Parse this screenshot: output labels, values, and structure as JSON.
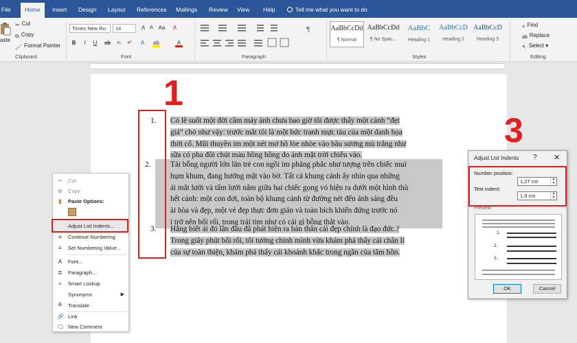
{
  "tabs": [
    {
      "label": "File"
    },
    {
      "label": "Home"
    },
    {
      "label": "Insert"
    },
    {
      "label": "Design"
    },
    {
      "label": "Layout"
    },
    {
      "label": "References"
    },
    {
      "label": "Mailings"
    },
    {
      "label": "Review"
    },
    {
      "label": "View"
    },
    {
      "label": "Help"
    }
  ],
  "tell_me": "Tell me what you want to do",
  "ribbon": {
    "clipboard": {
      "paste": "aste",
      "cut": "Cut",
      "copy": "Copy",
      "format_painter": "Format Painter",
      "label": "Clipboard"
    },
    "font": {
      "name": "Times New Ro",
      "size": "14",
      "label": "Font"
    },
    "paragraph": {
      "label": "Paragraph"
    },
    "styles": {
      "items": [
        {
          "sample": "AaBbCcDd",
          "name": "¶ Normal"
        },
        {
          "sample": "AaBbCcDd",
          "name": "¶ No Spac..."
        },
        {
          "sample": "AaBbC",
          "name": "Heading 1"
        },
        {
          "sample": "AaBbCcD",
          "name": "Heading 2"
        },
        {
          "sample": "AaBbCcD",
          "name": "Heading 3"
        }
      ],
      "label": "Styles"
    },
    "editing": {
      "find": "Find",
      "replace": "Replace",
      "select": "Select",
      "label": "Editing"
    }
  },
  "document": {
    "items": [
      {
        "number": "1.",
        "lines": [
          "Có lẽ suốt một đời cầm máy ảnh chưa bao giờ tôi được thấy một cảnh “đẹt",
          "giá” chó như vậy: trước mắt tôi là một bức tranh mực tàu của một danh họa",
          "thời cổ. Mũi thuyền im một nét mơ hồ lòe nhòe vào bầu sương mù trắng như",
          "sữa có pha đôi chút màu hồng hồng do ánh mặt trời chiếu vào."
        ]
      },
      {
        "number": "2.",
        "lines": [
          "Tài bỗng người lớn lãn trẻ con ngồi im phăng phắc như tượng trên chiếc mui",
          "hụm khum, đang hướng mặt vào bờ. Tất cả khung cảnh ấy nhìn qua những",
          "ái mắt lưới và tấm lưới nằm giữa hai chiếc gọng vó hiện ra dưới một hình thù",
          "hết cảnh: một con đơi, toàn bộ khung cảnh từ đường nét đến ánh sáng đều",
          "ài hòa và đẹp, một vẻ đẹp thực đơn giản và toàn bích khiến đứng trước nó",
          "i trở nên bối rối, trong trái tim như có cái gì bỗng thắt vào."
        ]
      },
      {
        "number": "3.",
        "lines": [
          "Hẳng biết ái đó lần đầu đã phát hiện ra bản thân cái đẹp chính là đạo đức.?",
          "Trong giây phút bối rối, tôi tưởng chính mình vừa khám phá thấy cái chân lí",
          "của sự toàn thiện, khám phá thấy cái khoảnh khắc trong ngần của tâm hồn."
        ]
      }
    ]
  },
  "annotations": {
    "one": "1",
    "two": "2",
    "three": "3"
  },
  "context_menu": {
    "cut": "Cut",
    "copy": "Copy",
    "paste_options": "Paste Options:",
    "adjust_list_indents": "Adjust List Indents...",
    "continue_numbering": "Continue Numbering",
    "set_numbering_value": "Set Numbering Value...",
    "font": "Font...",
    "paragraph": "Paragraph...",
    "smart_lookup": "Smart Lookup",
    "synonyms": "Synonyms",
    "translate": "Translate",
    "link": "Link",
    "new_comment": "New Comment"
  },
  "dialog": {
    "title": "Adjust List Indents",
    "help": "?",
    "close": "✕",
    "number_position_label": "Number position:",
    "number_position_value": "1,27 cm",
    "text_indent_label": "Text indent:",
    "text_indent_value": "1,9 cm",
    "preview_label": "Preview",
    "ok": "OK",
    "cancel": "Cancel",
    "preview_numbers": [
      "1.",
      "2.",
      "3."
    ]
  },
  "colors": {
    "ribbon_blue": "#2b579a",
    "highlight_gray": "#c8c8c8",
    "annotation_red": "#e02020"
  }
}
